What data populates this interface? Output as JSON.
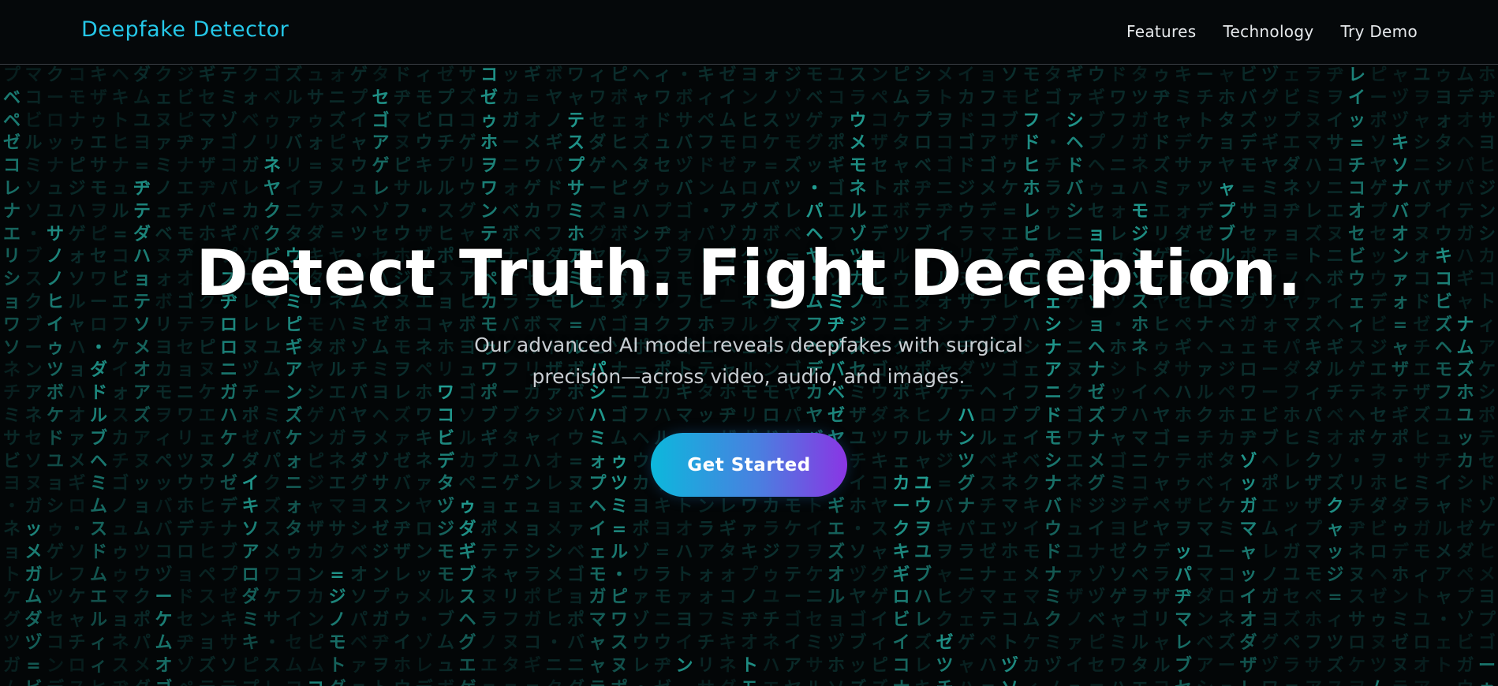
{
  "navbar": {
    "brand": "Deepfake Detector",
    "links": [
      "Features",
      "Technology",
      "Try Demo"
    ]
  },
  "hero": {
    "title": "Detect Truth. Fight Deception.",
    "subtitle": "Our advanced AI model reveals deepfakes with surgical precision—across video, audio, and images.",
    "cta_label": "Get Started"
  },
  "background": {
    "effect": "matrix-rain",
    "glyph_set": "アイウエオカキクケコサシスセソタチツテトナニヌネノハヒフヘホマミムメモヤユヨラリルレロワヲンガギグゲゴザジズゼゾダヂヅデドバビブベボパピプペポァィゥェォッャュョ・ー=",
    "accent_color": "#1fc4b4",
    "text_color_bright": "#2fe0cf",
    "text_color_dim": "#0e3c3a"
  },
  "colors": {
    "brand": "#25c7e8",
    "button_gradient_start": "#0cb8dc",
    "button_gradient_end": "#8a35e4"
  }
}
